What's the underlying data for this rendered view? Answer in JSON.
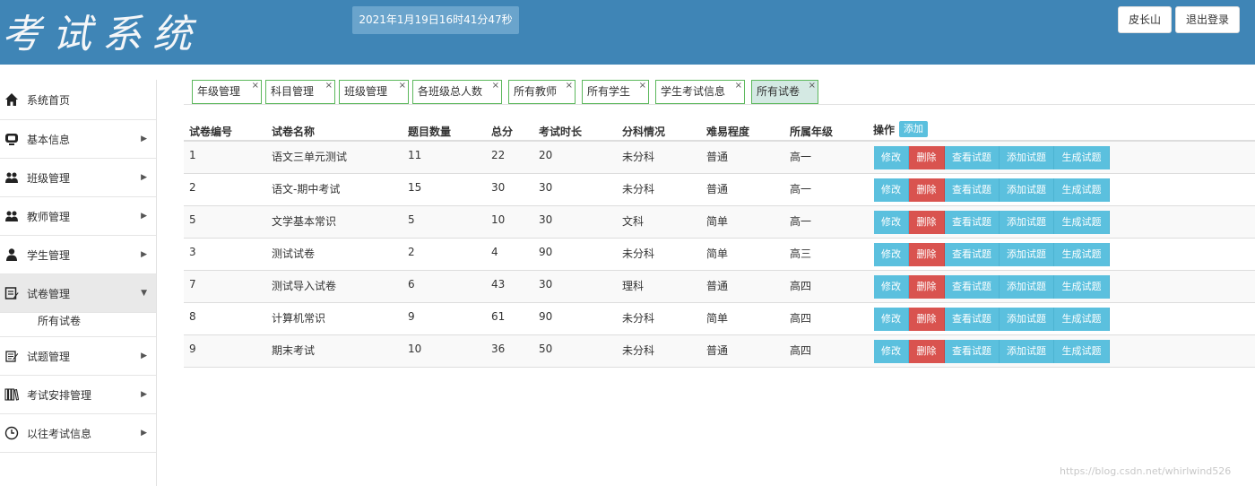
{
  "header": {
    "title": "考试系统",
    "datetime": "2021年1月19日16时41分47秒",
    "user_button": "皮长山",
    "logout_button": "退出登录"
  },
  "sidebar": {
    "items": [
      {
        "label": "系统首页",
        "icon": "home-icon",
        "caret": ""
      },
      {
        "label": "基本信息",
        "icon": "monitor-icon",
        "caret": "▶"
      },
      {
        "label": "班级管理",
        "icon": "group-icon",
        "caret": "▶"
      },
      {
        "label": "教师管理",
        "icon": "group-icon",
        "caret": "▶"
      },
      {
        "label": "学生管理",
        "icon": "person-icon",
        "caret": "▶"
      },
      {
        "label": "试卷管理",
        "icon": "edit-icon",
        "caret": "▼"
      },
      {
        "label": "试题管理",
        "icon": "notepad-icon",
        "caret": "▶"
      },
      {
        "label": "考试安排管理",
        "icon": "books-icon",
        "caret": "▶"
      },
      {
        "label": "以往考试信息",
        "icon": "clock-icon",
        "caret": "▶"
      }
    ],
    "sub_item": "所有试卷"
  },
  "tabs": [
    {
      "label": "年级管理",
      "close": "×"
    },
    {
      "label": "科目管理",
      "close": "×"
    },
    {
      "label": "班级管理",
      "close": "×"
    },
    {
      "label": "各班级总人数",
      "close": "×"
    },
    {
      "label": "所有教师",
      "close": "×"
    },
    {
      "label": "所有学生",
      "close": "×"
    },
    {
      "label": "学生考试信息",
      "close": "×"
    },
    {
      "label": "所有试卷",
      "close": "×"
    }
  ],
  "table": {
    "headers": [
      "试卷编号",
      "试卷名称",
      "题目数量",
      "总分",
      "考试时长",
      "分科情况",
      "难易程度",
      "所属年级",
      "操作"
    ],
    "add_button": "添加",
    "actions": {
      "edit": "修改",
      "delete": "删除",
      "view": "查看试题",
      "add": "添加试题",
      "generate": "生成试题"
    },
    "rows": [
      [
        "1",
        "语文三单元测试",
        "11",
        "22",
        "20",
        "未分科",
        "普通",
        "高一"
      ],
      [
        "2",
        "语文-期中考试",
        "15",
        "30",
        "30",
        "未分科",
        "普通",
        "高一"
      ],
      [
        "5",
        "文学基本常识",
        "5",
        "10",
        "30",
        "文科",
        "简单",
        "高一"
      ],
      [
        "3",
        "测试试卷",
        "2",
        "4",
        "90",
        "未分科",
        "简单",
        "高三"
      ],
      [
        "7",
        "测试导入试卷",
        "6",
        "43",
        "30",
        "理科",
        "普通",
        "高四"
      ],
      [
        "8",
        "计算机常识",
        "9",
        "61",
        "90",
        "未分科",
        "简单",
        "高四"
      ],
      [
        "9",
        "期末考试",
        "10",
        "36",
        "50",
        "未分科",
        "普通",
        "高四"
      ]
    ]
  },
  "watermark": "https://blog.csdn.net/whirlwind526",
  "colors": {
    "header_bg": "#3f85b6",
    "info": "#5bc0de",
    "danger": "#d9534f",
    "tab_border": "#5cb85c"
  }
}
